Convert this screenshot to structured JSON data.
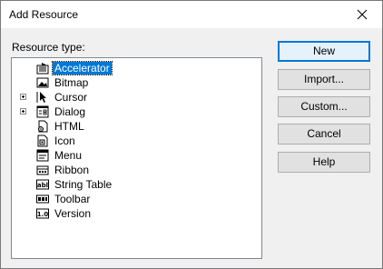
{
  "window": {
    "title": "Add Resource"
  },
  "resource_type_label": "Resource type:",
  "tree": {
    "items": [
      {
        "label": "Accelerator",
        "icon": "accelerator-icon",
        "expandable": false,
        "selected": true
      },
      {
        "label": "Bitmap",
        "icon": "bitmap-icon",
        "expandable": false,
        "selected": false
      },
      {
        "label": "Cursor",
        "icon": "cursor-icon",
        "expandable": true,
        "selected": false
      },
      {
        "label": "Dialog",
        "icon": "dialog-icon",
        "expandable": true,
        "selected": false
      },
      {
        "label": "HTML",
        "icon": "html-icon",
        "expandable": false,
        "selected": false
      },
      {
        "label": "Icon",
        "icon": "icon-resource-icon",
        "expandable": false,
        "selected": false
      },
      {
        "label": "Menu",
        "icon": "menu-icon",
        "expandable": false,
        "selected": false
      },
      {
        "label": "Ribbon",
        "icon": "ribbon-icon",
        "expandable": false,
        "selected": false
      },
      {
        "label": "String Table",
        "icon": "string-table-icon",
        "expandable": false,
        "selected": false
      },
      {
        "label": "Toolbar",
        "icon": "toolbar-icon",
        "expandable": false,
        "selected": false
      },
      {
        "label": "Version",
        "icon": "version-icon",
        "expandable": false,
        "selected": false
      }
    ]
  },
  "buttons": {
    "new": "New",
    "import": "Import...",
    "custom": "Custom...",
    "cancel": "Cancel",
    "help": "Help"
  },
  "colors": {
    "selection": "#0078d7",
    "default_button_border": "#0078d7"
  }
}
